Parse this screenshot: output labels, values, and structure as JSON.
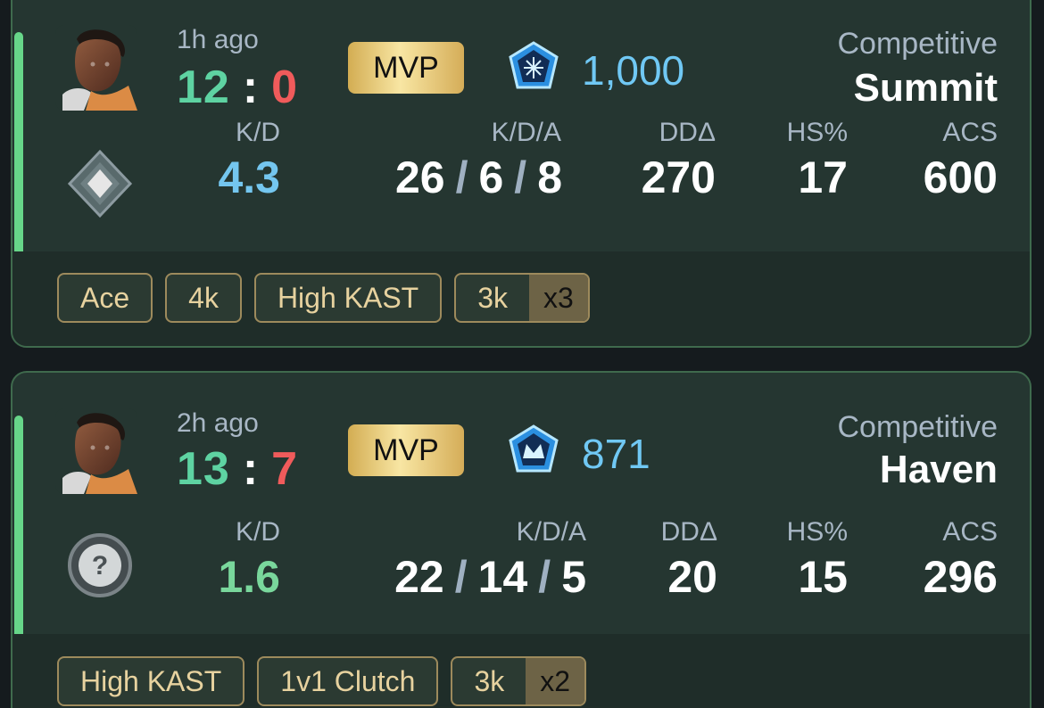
{
  "matches": [
    {
      "time_ago": "1h ago",
      "score_win": "12",
      "score_lose": "0",
      "score_separator": ":",
      "mvp_label": "MVP",
      "rank_rating": "1,000",
      "mode": "Competitive",
      "map": "Summit",
      "stats": {
        "kd_label": "K/D",
        "kd_value": "4.3",
        "kda_label": "K/D/A",
        "kills": "26",
        "deaths": "6",
        "assists": "8",
        "dda_label": "DDΔ",
        "dda_value": "270",
        "hs_label": "HS%",
        "hs_value": "17",
        "acs_label": "ACS",
        "acs_value": "600"
      },
      "badges": [
        "Ace",
        "4k",
        "High KAST"
      ],
      "multi_badge": {
        "label": "3k",
        "count": "x3"
      },
      "icons": {
        "agent": "agent-portrait-icon",
        "rank": "rank-blue-pentagon-icon",
        "peak": "silver-diamond-icon"
      }
    },
    {
      "time_ago": "2h ago",
      "score_win": "13",
      "score_lose": "7",
      "score_separator": ":",
      "mvp_label": "MVP",
      "rank_rating": "871",
      "mode": "Competitive",
      "map": "Haven",
      "stats": {
        "kd_label": "K/D",
        "kd_value": "1.6",
        "kda_label": "K/D/A",
        "kills": "22",
        "deaths": "14",
        "assists": "5",
        "dda_label": "DDΔ",
        "dda_value": "20",
        "hs_label": "HS%",
        "hs_value": "15",
        "acs_label": "ACS",
        "acs_value": "296"
      },
      "badges": [
        "High KAST",
        "1v1 Clutch"
      ],
      "multi_badge": {
        "label": "3k",
        "count": "x2"
      },
      "icons": {
        "agent": "agent-portrait-icon",
        "rank": "rank-blue-crown-icon",
        "peak": "question-mark-icon"
      }
    }
  ],
  "colors": {
    "background": "#151b1e",
    "card": "#253631",
    "accent": "#67d689",
    "win": "#5ed3a2",
    "lose": "#f05b5b",
    "rr": "#70c8f4",
    "mvp_gold": "#f8e6a3",
    "badge_text": "#e7d29f"
  }
}
